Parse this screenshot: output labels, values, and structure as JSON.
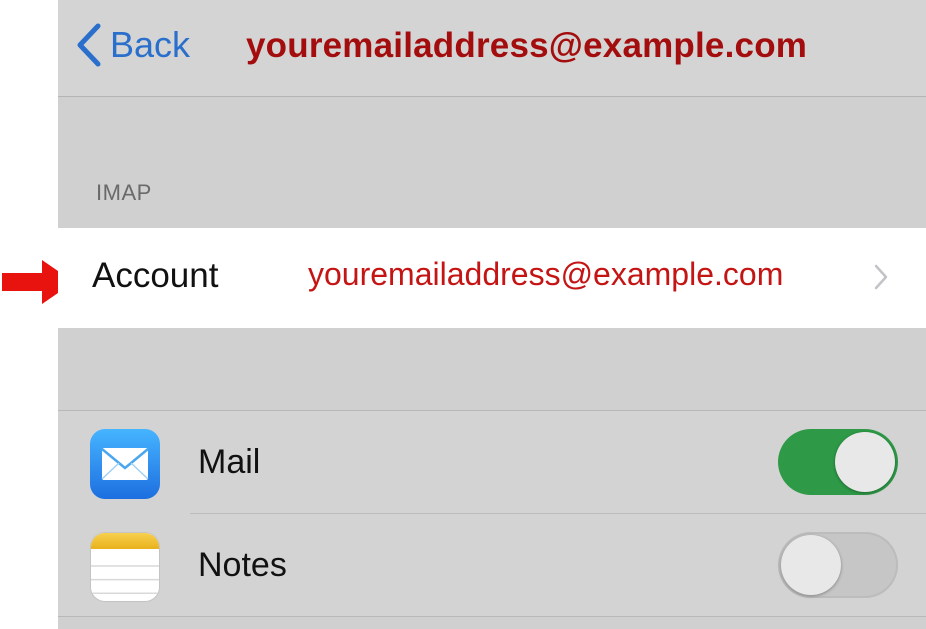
{
  "navbar": {
    "back_label": "Back",
    "title": "youremailaddress@example.com"
  },
  "section_header": "IMAP",
  "account_row": {
    "label": "Account",
    "value": "youremailaddress@example.com"
  },
  "app_rows": [
    {
      "label": "Mail",
      "icon": "mail-icon",
      "enabled": true
    },
    {
      "label": "Notes",
      "icon": "notes-icon",
      "enabled": false
    }
  ],
  "colors": {
    "accent_blue": "#2a6fcc",
    "highlight_red": "#c41414",
    "toggle_on": "#2e9a47",
    "arrow": "#e8120e"
  },
  "annotation": {
    "icon": "red-pointer-arrow"
  }
}
